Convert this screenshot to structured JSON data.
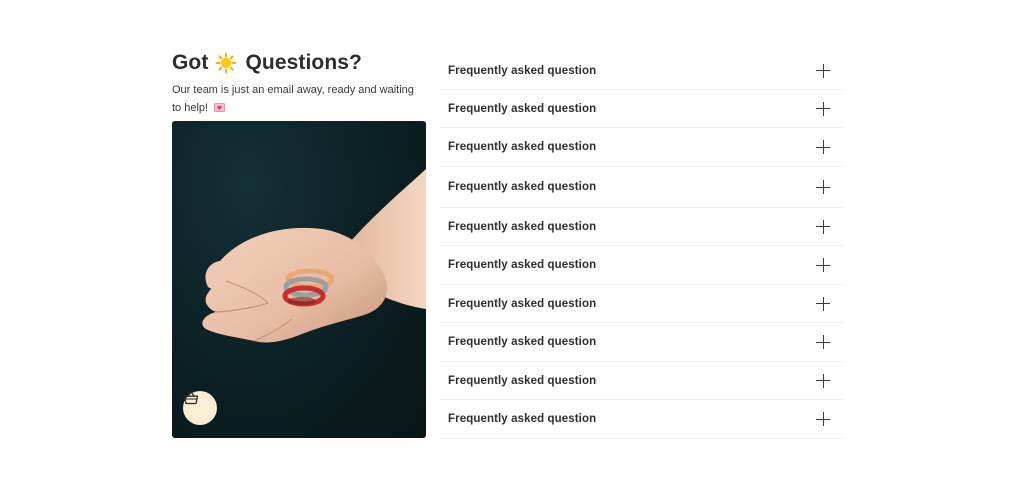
{
  "header": {
    "title_prefix": "Got",
    "title_suffix": "Questions?",
    "sun_icon": "sun-emoji-icon",
    "subtitle": "Our team is just an email away, ready and waiting to help!",
    "heart_icon": "heart-letter-emoji-icon"
  },
  "photo": {
    "image_icon": "hand-holding-rings-photo",
    "button_icon": "basket-icon",
    "button_bg": "#fbeed3"
  },
  "faq": {
    "items": [
      {
        "question": "Frequently asked question"
      },
      {
        "question": "Frequently asked question"
      },
      {
        "question": "Frequently asked question"
      },
      {
        "question": "Frequently asked question"
      },
      {
        "question": "Frequently asked question"
      },
      {
        "question": "Frequently asked question"
      },
      {
        "question": "Frequently asked question"
      },
      {
        "question": "Frequently asked question"
      },
      {
        "question": "Frequently asked question"
      },
      {
        "question": "Frequently asked question"
      }
    ],
    "expand_icon": "plus-icon"
  }
}
